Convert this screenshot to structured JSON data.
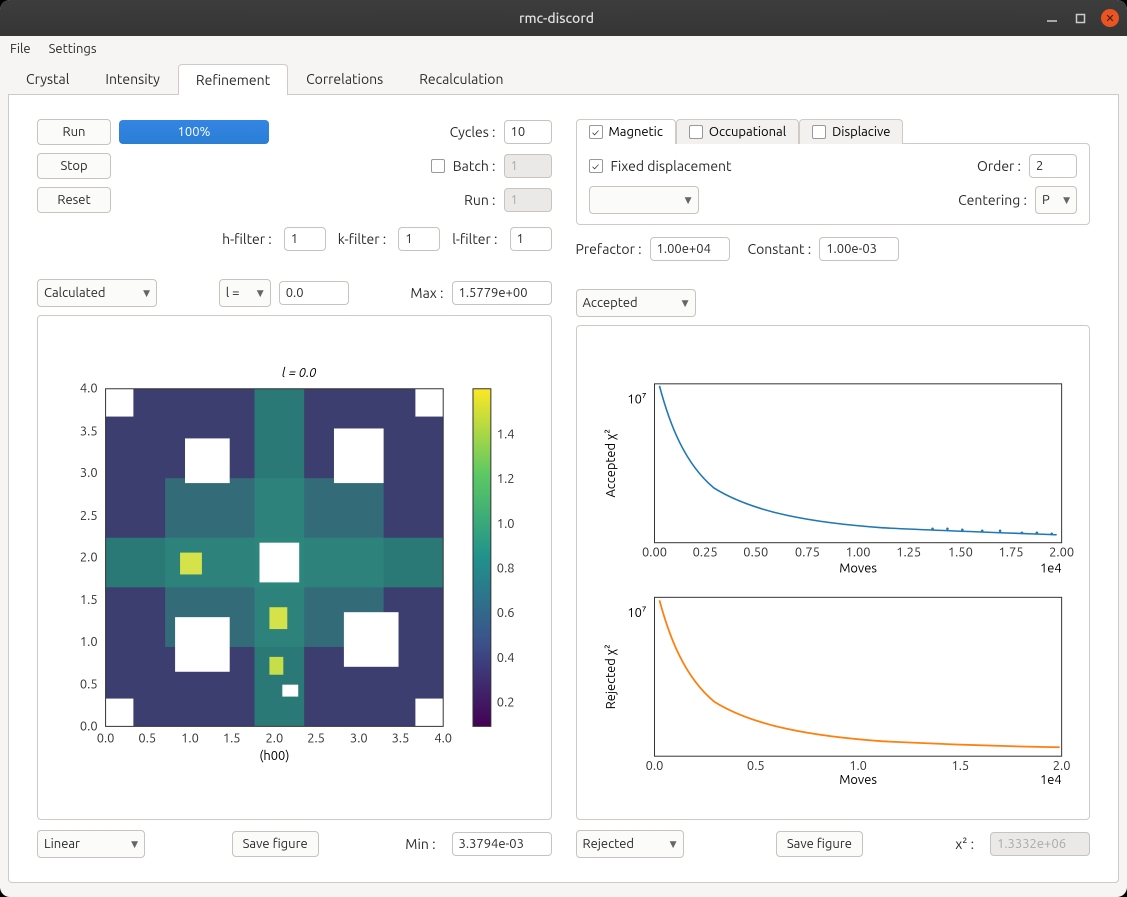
{
  "window": {
    "title": "rmc-discord"
  },
  "menu": {
    "file": "File",
    "settings": "Settings"
  },
  "tabs": {
    "crystal": "Crystal",
    "intensity": "Intensity",
    "refinement": "Refinement",
    "correlations": "Correlations",
    "recalculation": "Recalculation"
  },
  "left": {
    "run": "Run",
    "stop": "Stop",
    "reset": "Reset",
    "progress": "100%",
    "cycles_label": "Cycles :",
    "cycles": "10",
    "batch_label": "Batch :",
    "batch": "1",
    "run_label": "Run :",
    "run_val": "1",
    "hfilter_label": "h-filter :",
    "hfilter": "1",
    "kfilter_label": "k-filter :",
    "kfilter": "1",
    "lfilter_label": "l-filter :",
    "lfilter": "1",
    "source_sel": "Calculated",
    "axis_sel": "l =",
    "axis_val": "0.0",
    "max_label": "Max :",
    "max_val": "1.5779e+00",
    "heatmap_title": "l = 0.0",
    "heatmap_xlabel": "(h00)",
    "scale_sel": "Linear",
    "save_figure": "Save figure",
    "min_label": "Min :",
    "min_val": "3.3794e-03"
  },
  "right": {
    "tab_magnetic": "Magnetic",
    "tab_occupational": "Occupational",
    "tab_displacive": "Displacive",
    "fixed_disp": "Fixed displacement",
    "order_label": "Order :",
    "order": "2",
    "centering_label": "Centering :",
    "centering": "P",
    "prefactor_label": "Prefactor :",
    "prefactor": "1.00e+04",
    "constant_label": "Constant :",
    "constant": "1.00e-03",
    "accepted_sel": "Accepted",
    "accepted_ylabel": "Accepted χ²",
    "rejected_ylabel": "Rejected χ²",
    "moves_label": "Moves",
    "xexp": "1e4",
    "ytick": "10⁷",
    "rejected_sel": "Rejected",
    "save_figure": "Save figure",
    "x2_label": "x² :",
    "x2_val": "1.3332e+06"
  },
  "chart_data": [
    {
      "type": "heatmap",
      "title": "l = 0.0",
      "xlabel": "(h00)",
      "ylabel": "",
      "xlim": [
        0.0,
        4.0
      ],
      "ylim": [
        0.0,
        4.0
      ],
      "clim": [
        0.0,
        1.5
      ],
      "xticks": [
        0.0,
        0.5,
        1.0,
        1.5,
        2.0,
        2.5,
        3.0,
        3.5,
        4.0
      ],
      "yticks": [
        0.0,
        0.5,
        1.0,
        1.5,
        2.0,
        2.5,
        3.0,
        3.5,
        4.0
      ],
      "colorbar_ticks": [
        0.2,
        0.4,
        0.6,
        0.8,
        1.0,
        1.2,
        1.4
      ],
      "note": "diffuse scattering map, viridis colormap, several masked white regions"
    },
    {
      "type": "line",
      "ylabel": "Accepted χ²",
      "xlabel": "Moves",
      "xlim": [
        0,
        2.0
      ],
      "x_scale": "1e4",
      "yscale": "log",
      "xticks": [
        0.0,
        0.25,
        0.5,
        0.75,
        1.0,
        1.25,
        1.5,
        1.75,
        2.0
      ],
      "yticks_shown": [
        "1e7"
      ],
      "series": [
        {
          "name": "accepted",
          "color": "#1f77b4",
          "x": [
            0.0,
            0.05,
            0.1,
            0.15,
            0.2,
            0.25,
            0.3,
            0.4,
            0.5,
            0.6,
            0.75,
            1.0,
            1.25,
            1.5,
            1.75,
            2.0
          ],
          "y": [
            12000000.0,
            6500000.0,
            4800000.0,
            3800000.0,
            3200000.0,
            2800000.0,
            2500000.0,
            2200000.0,
            2000000.0,
            1850000.0,
            1720000.0,
            1580000.0,
            1500000.0,
            1440000.0,
            1400000.0,
            1360000.0
          ]
        }
      ]
    },
    {
      "type": "line",
      "ylabel": "Rejected χ²",
      "xlabel": "Moves",
      "xlim": [
        0,
        2.0
      ],
      "x_scale": "1e4",
      "yscale": "log",
      "xticks": [
        0.0,
        0.5,
        1.0,
        1.5,
        2.0
      ],
      "yticks_shown": [
        "1e7"
      ],
      "series": [
        {
          "name": "rejected",
          "color": "#ff7f0e",
          "x": [
            0.0,
            0.05,
            0.1,
            0.15,
            0.2,
            0.25,
            0.3,
            0.4,
            0.5,
            0.6,
            0.75,
            1.0,
            1.25,
            1.5,
            1.75,
            2.0
          ],
          "y": [
            11500000.0,
            6300000.0,
            4700000.0,
            3700000.0,
            3100000.0,
            2750000.0,
            2500000.0,
            2200000.0,
            2000000.0,
            1850000.0,
            1700000.0,
            1550000.0,
            1480000.0,
            1420000.0,
            1380000.0,
            1340000.0
          ]
        }
      ]
    }
  ]
}
